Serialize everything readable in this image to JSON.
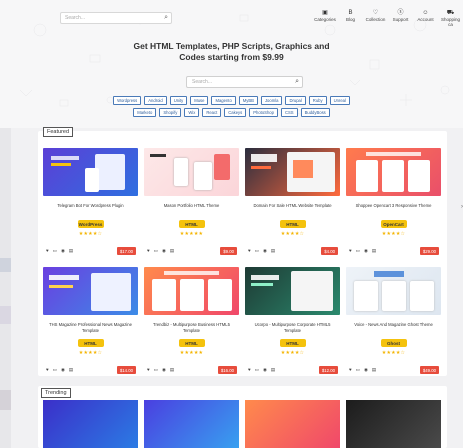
{
  "header": {
    "search_placeholder": "Search...",
    "nav": [
      {
        "label": "Categories",
        "icon": "tags-icon",
        "glyph": "▣"
      },
      {
        "label": "Blog",
        "icon": "blog-icon",
        "glyph": "B"
      },
      {
        "label": "Collection",
        "icon": "heart-icon",
        "glyph": "♡"
      },
      {
        "label": "Support",
        "icon": "support-icon",
        "glyph": "ⓢ"
      },
      {
        "label": "Account",
        "icon": "user-icon",
        "glyph": "☺"
      },
      {
        "label": "Shopping ca",
        "icon": "cart-icon",
        "glyph": "⛟"
      }
    ]
  },
  "hero": {
    "headline_line1": "Get HTML Templates, PHP Scripts, Graphics and",
    "headline_line2": "Codes starting from $9.99",
    "search_placeholder": "Search...",
    "tags_row1": [
      "Wordpress",
      "Android",
      "Unity",
      "Muse",
      "Magento",
      "MyBB",
      "Joomla",
      "Drupal",
      "Ruby",
      "Unreal"
    ],
    "tags_row2": [
      "Marketo",
      "Shopify",
      "Wix",
      "React",
      "Cakeys",
      "PhotoShop",
      "CSS",
      "BuddyBoss"
    ]
  },
  "featured": {
    "title": "Featured",
    "cards": [
      {
        "title": "Telegram Bot For Wordpress Plugin",
        "badge": "WordPress",
        "stars": "★★★★☆",
        "price": "$17.00"
      },
      {
        "title": "Mason Portfolio HTML Theme",
        "badge": "HTML",
        "stars": "★★★★★",
        "price": "$9.00"
      },
      {
        "title": "Domain For Sale HTML Website Template",
        "badge": "HTML",
        "stars": "★★★★☆",
        "price": "$4.00"
      },
      {
        "title": "Shoppee Opencart 3 Responsive Theme",
        "badge": "OpenCart",
        "stars": "★★★★☆",
        "price": "$29.00"
      },
      {
        "title": "THS Magazine Professional News Magazine Template",
        "badge": "HTML",
        "stars": "★★★★☆",
        "price": "$14.00"
      },
      {
        "title": "Trendbiz - Multipurpose Business HTML5 Template",
        "badge": "HTML",
        "stars": "★★★★★",
        "price": "$16.00"
      },
      {
        "title": "Ucorpo - Multipurpose Corporate HTML5 Template",
        "badge": "HTML",
        "stars": "★★★★☆",
        "price": "$12.00"
      },
      {
        "title": "Voice - News And Magazine Ghost Theme",
        "badge": "Ghost",
        "stars": "★★★★☆",
        "price": "$49.00"
      }
    ]
  },
  "trending": {
    "title": "Trending"
  },
  "colors": {
    "accent_yellow": "#f4c20d",
    "price_red": "#e74c3c",
    "tag_blue": "#4a7ab8"
  }
}
